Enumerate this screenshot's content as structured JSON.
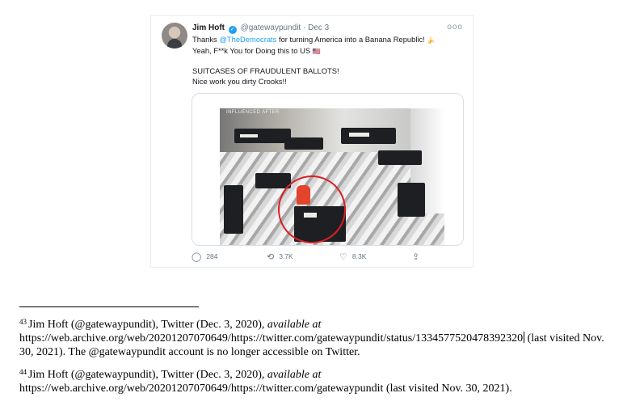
{
  "tweet": {
    "name": "Jim Hoft",
    "verified_icon": "verified-icon",
    "handle": "@gatewaypundit",
    "separator": "·",
    "date": "Dec 3",
    "more": "ooo",
    "line1_a": "Thanks ",
    "mention": "@TheDemocrats",
    "line1_b": " for turning America into a Banana Republic!",
    "line1_emoji": "🍌",
    "line2": "Yeah, F**k You for Doing this to US",
    "line2_emoji": "🇺🇸",
    "line3": "SUITCASES OF FRAUDULENT BALLOTS!",
    "line4": "Nice work you dirty Crooks!!",
    "media_overlay": "INFLUENCED AFTER",
    "actions": [
      {
        "icon": "reply-icon",
        "glyph": "◯",
        "count": "284"
      },
      {
        "icon": "retweet-icon",
        "glyph": "⟲",
        "count": "3.7K"
      },
      {
        "icon": "like-icon",
        "glyph": "♡",
        "count": "8.3K"
      },
      {
        "icon": "share-icon",
        "glyph": "⇪",
        "count": ""
      }
    ]
  },
  "footnotes": [
    {
      "number": "43",
      "text_before": "Jim Hoft (@gatewaypundit), Twitter (Dec. 3, 2020), ",
      "italic": "available at",
      "url": "https://web.archive.org/web/20201207070649/https://twitter.com/gatewaypundit/status/1334577520478392320",
      "after_url": " (last visited Nov. 30, 2021). The @gatewaypundit account is no longer accessible on Twitter."
    },
    {
      "number": "44",
      "text_before": "Jim Hoft (@gatewaypundit), Twitter (Dec. 3, 2020), ",
      "italic": "available at",
      "url": "https://web.archive.org/web/20201207070649/https://twitter.com/gatewaypundit",
      "after_url": " (last visited Nov. 30, 2021)."
    }
  ]
}
